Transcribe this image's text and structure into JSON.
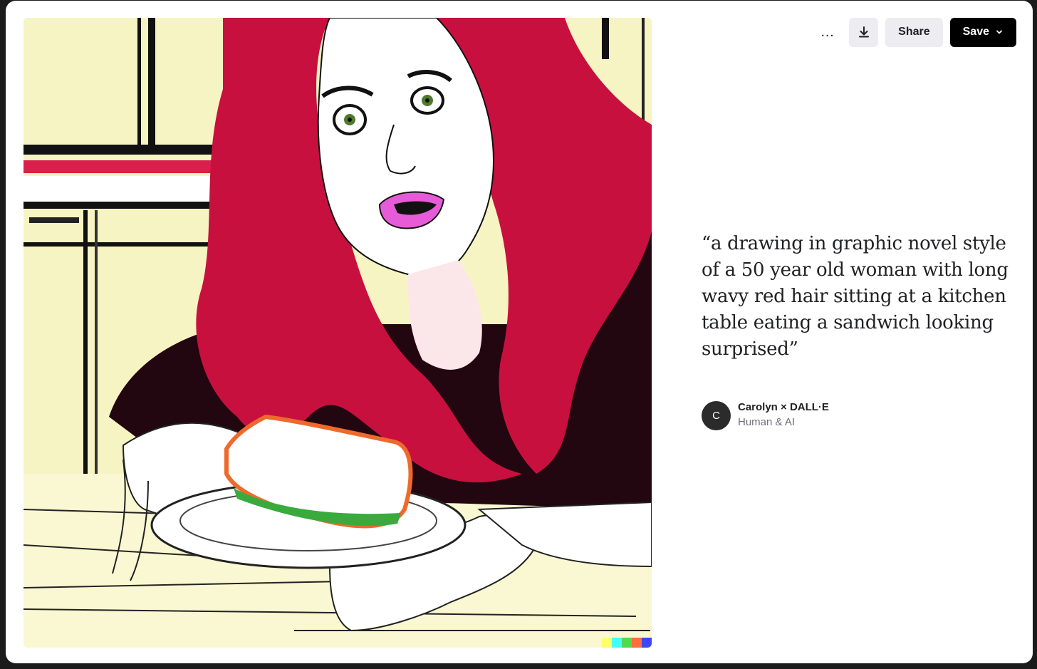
{
  "toolbar": {
    "more_label": "…",
    "share_label": "Share",
    "save_label": "Save"
  },
  "prompt": {
    "text": "“a drawing in graphic novel style of a 50 year old woman with long wavy red hair sitting at a kitchen table eating a sandwich looking surprised”"
  },
  "author": {
    "initial": "C",
    "name": "Carolyn × DALL·E",
    "subtitle": "Human & AI"
  },
  "icons": {
    "more": "ellipsis-icon",
    "download": "download-icon",
    "save_caret": "chevron-down-icon"
  },
  "colors": {
    "save_bg": "#000000",
    "secondary_bg": "#ececf1",
    "hair": "#c8103e",
    "kitchen": "#f7f4c4",
    "signature": [
      "#ffff66",
      "#42ffff",
      "#51da4c",
      "#ff6e3c",
      "#3c46ff"
    ]
  }
}
